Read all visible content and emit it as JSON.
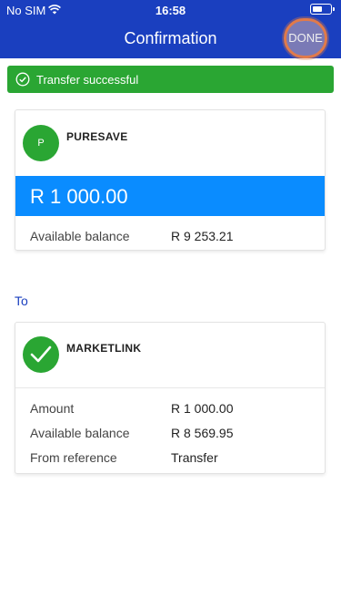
{
  "status_bar": {
    "carrier": "No SIM",
    "time": "16:58",
    "wifi_icon": "wifi-icon",
    "battery_icon": "battery-icon"
  },
  "nav": {
    "title": "Confirmation",
    "done_label": "DONE"
  },
  "toast": {
    "message": "Transfer successful",
    "icon": "check-circle-icon",
    "color": "#2aa633"
  },
  "from_account": {
    "avatar_letter": "P",
    "name": "PURESAVE",
    "amount": "R 1 000.00",
    "rows": [
      {
        "label": "Available balance",
        "value": "R 9 253.21"
      }
    ]
  },
  "to_section": {
    "label": "To"
  },
  "to_account": {
    "avatar_icon": "checkmark-icon",
    "name": "MARKETLINK",
    "rows": [
      {
        "label": "Amount",
        "value": "R 1 000.00"
      },
      {
        "label": "Available balance",
        "value": "R 8 569.95"
      },
      {
        "label": "From reference",
        "value": "Transfer"
      }
    ]
  },
  "colors": {
    "header": "#1a3fbf",
    "amount_bar": "#0a8cff",
    "success": "#2aa633"
  }
}
